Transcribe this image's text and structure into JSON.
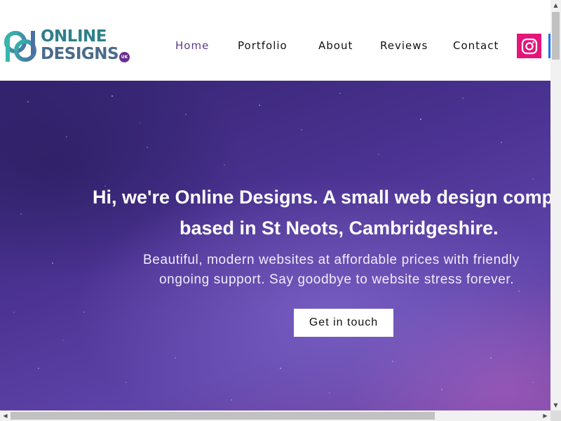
{
  "logo": {
    "line1": "ONLINE",
    "line2": "DESIGNS",
    "badge": "UK"
  },
  "nav": {
    "items": [
      {
        "label": "Home",
        "active": true
      },
      {
        "label": "Portfolio"
      },
      {
        "label": "About"
      },
      {
        "label": "Reviews"
      },
      {
        "label": "Contact"
      }
    ]
  },
  "social": [
    {
      "icon": "instagram-icon",
      "color": "#e4157c"
    },
    {
      "icon": "facebook-icon",
      "color": "#1877f2"
    }
  ],
  "hero": {
    "title_line1": "Hi, we're Online Designs. A small web design comp",
    "title_line2": "based in St Neots, Cambridgeshire.",
    "subtitle_line1": "Beautiful, modern websites at affordable prices with friendly",
    "subtitle_line2": "ongoing support. Say goodbye to website stress forever.",
    "cta_label": "Get in touch"
  },
  "colors": {
    "accent": "#5b3a8c",
    "hero_purple": "#4a3291",
    "instagram": "#e4157c",
    "facebook": "#1877f2"
  }
}
